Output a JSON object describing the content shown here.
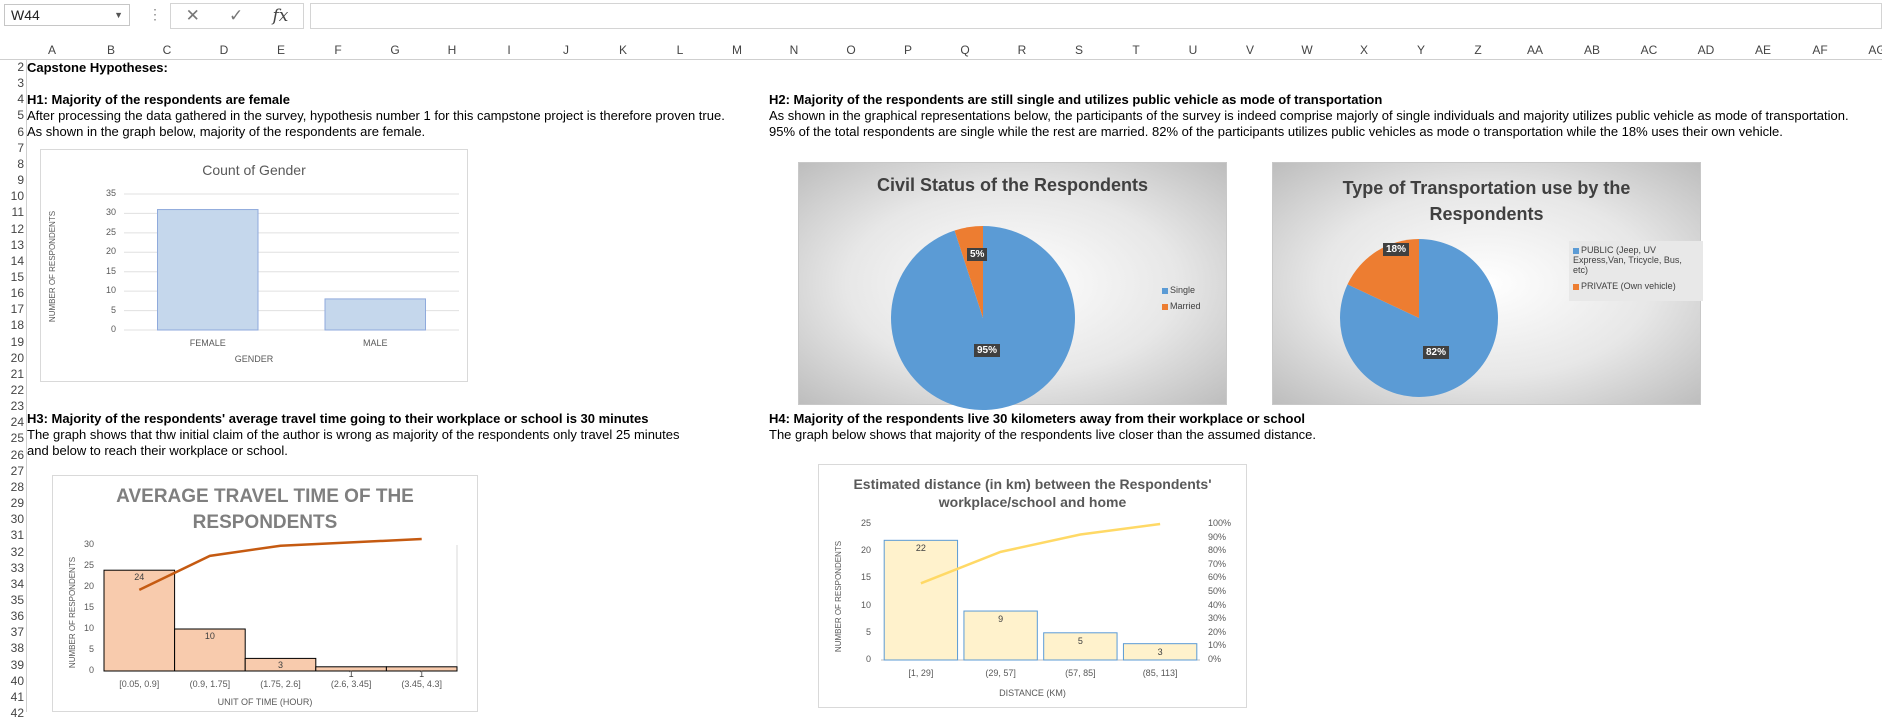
{
  "name_box": {
    "value": "W44"
  },
  "formula_bar": {
    "value": "",
    "fx_label": "fx"
  },
  "columns": [
    "A",
    "B",
    "C",
    "D",
    "E",
    "F",
    "G",
    "H",
    "I",
    "J",
    "K",
    "L",
    "M",
    "N",
    "O",
    "P",
    "Q",
    "R",
    "S",
    "T",
    "U",
    "V",
    "W",
    "X",
    "Y",
    "Z",
    "AA",
    "AB",
    "AC",
    "AD",
    "AE",
    "AF",
    "AG"
  ],
  "rows": [
    "2",
    "3",
    "4",
    "5",
    "6",
    "7",
    "8",
    "9",
    "10",
    "11",
    "12",
    "13",
    "14",
    "15",
    "16",
    "17",
    "18",
    "19",
    "20",
    "21",
    "22",
    "23",
    "24",
    "25",
    "26",
    "27",
    "28",
    "29",
    "30",
    "31",
    "32",
    "33",
    "34",
    "35",
    "36",
    "37",
    "38",
    "39",
    "40",
    "41",
    "42"
  ],
  "sheet": {
    "title": "Capstone Hypotheses:",
    "h1_title": "H1: Majority of the respondents are female",
    "h1_line1": "After processing the data gathered in the survey, hypothesis number 1 for this campstone project is therefore proven true.",
    "h1_line2": "As shown in the graph below, majority of the respondents are female.",
    "h2_title": "H2: Majority of the respondents are still single and utilizes public vehicle as mode of transportation",
    "h2_line1": "As shown in the graphical representations below, the participants of the survey is indeed comprise majorly of single individuals and majority utilizes public vehicle as mode of transportation.",
    "h2_line2": "95% of the total respondents are  single while the rest are married. 82% of the participants utilizes public vehicles as mode o transportation while the 18% uses their own vehicle.",
    "h3_title": "H3: Majority of the respondents' average travel time going to their workplace or school is 30 minutes",
    "h3_line1": "The graph shows that thw initial claim of the author is wrong as majority of the respondents only travel  25 minutes",
    "h3_line2": "and below to reach their workplace or school.",
    "h4_title": "H4: Majority of the respondents live 30 kilometers away from their workplace or school",
    "h4_line1": "The graph below shows that majority of the respondents live closer than the assumed distance."
  },
  "chart_data": [
    {
      "type": "bar",
      "title": "Count of Gender",
      "categories": [
        "FEMALE",
        "MALE"
      ],
      "values": [
        31,
        8
      ],
      "xlabel": "GENDER",
      "ylabel": "NUMBER OF RESPONDENTS",
      "ylim": [
        0,
        35
      ],
      "yticks": [
        "0",
        "5",
        "10",
        "15",
        "20",
        "25",
        "30",
        "35"
      ],
      "colors": {
        "bar": "#c5d7ec"
      }
    },
    {
      "type": "pie",
      "title": "Civil Status of the Respondents",
      "categories": [
        "Single",
        "Married"
      ],
      "values": [
        95,
        5
      ],
      "labels": [
        "95%",
        "5%"
      ],
      "colors": [
        "#5b9bd5",
        "#ed7d31"
      ],
      "legend": "right"
    },
    {
      "type": "pie",
      "title": "Type of Transportation use by the Respondents",
      "categories": [
        "PUBLIC (Jeep, UV Express,Van, Tricycle, Bus, etc)",
        "PRIVATE (Own vehicle)"
      ],
      "values": [
        82,
        18
      ],
      "labels": [
        "82%",
        "18%"
      ],
      "colors": [
        "#5b9bd5",
        "#ed7d31"
      ],
      "legend": "right"
    },
    {
      "type": "bar",
      "title": "AVERAGE TRAVEL TIME OF THE RESPONDENTS",
      "categories": [
        "[0.05, 0.9]",
        "(0.9, 1.75]",
        "(1.75, 2.6]",
        "(2.6, 3.45]",
        "(3.45, 4.3]"
      ],
      "values": [
        24,
        10,
        3,
        1,
        1
      ],
      "cumulative_percent": [
        61.5,
        87.2,
        94.9,
        97.4,
        100
      ],
      "xlabel": "UNIT OF TIME (HOUR)",
      "ylabel": "NUMBER OF RESPONDENTS",
      "ylim": [
        0,
        30
      ],
      "yticks": [
        "0",
        "5",
        "10",
        "15",
        "20",
        "25",
        "30"
      ],
      "colors": {
        "bar": "#f8cbad",
        "line": "#c55a11"
      }
    },
    {
      "type": "bar",
      "title": "Estimated distance (in km) between the Respondents' workplace/school and home",
      "categories": [
        "[1, 29]",
        "(29, 57]",
        "(57, 85]",
        "(85, 113]"
      ],
      "values": [
        22,
        9,
        5,
        3
      ],
      "cumulative_percent": [
        56.4,
        79.5,
        92.3,
        100
      ],
      "xlabel": "DISTANCE (KM)",
      "ylabel": "NUMBER OF RESPONDENTS",
      "ylim": [
        0,
        25
      ],
      "yticks": [
        "0",
        "5",
        "10",
        "15",
        "20",
        "25"
      ],
      "y2ticks": [
        "0%",
        "10%",
        "20%",
        "30%",
        "40%",
        "50%",
        "60%",
        "70%",
        "80%",
        "90%",
        "100%"
      ],
      "colors": {
        "bar": "#fff2cc",
        "line": "#ffd966"
      }
    }
  ]
}
